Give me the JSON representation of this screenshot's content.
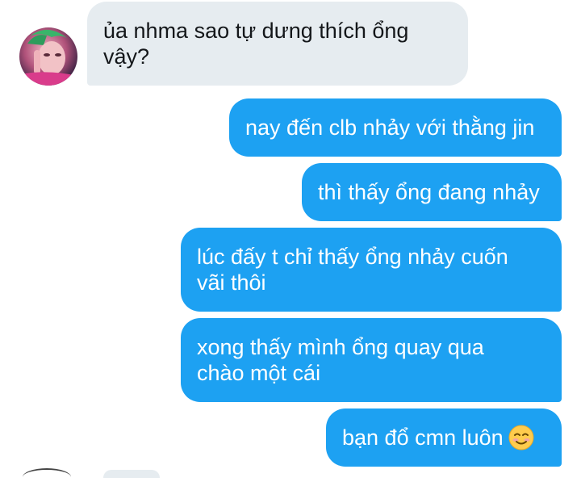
{
  "conversation": {
    "incoming": [
      {
        "text": "ủa nhma sao tự dưng thích ổng\nvậy?"
      }
    ],
    "outgoing": [
      {
        "text": "nay đến clb nhảy với thằng jin"
      },
      {
        "text": "thì thấy ổng đang nhảy"
      },
      {
        "text": "lúc đấy t chỉ thấy ổng nhảy cuốn\nvãi thôi"
      },
      {
        "text": "xong thấy mình ổng quay qua\nchào một cái"
      },
      {
        "text": "bạn đổ cmn luôn",
        "emoji": "smiling-face-icon"
      }
    ]
  },
  "colors": {
    "incoming_bubble": "#e6ecf0",
    "outgoing_bubble": "#1da1f2",
    "incoming_text": "#14171a",
    "outgoing_text": "#ffffff"
  }
}
